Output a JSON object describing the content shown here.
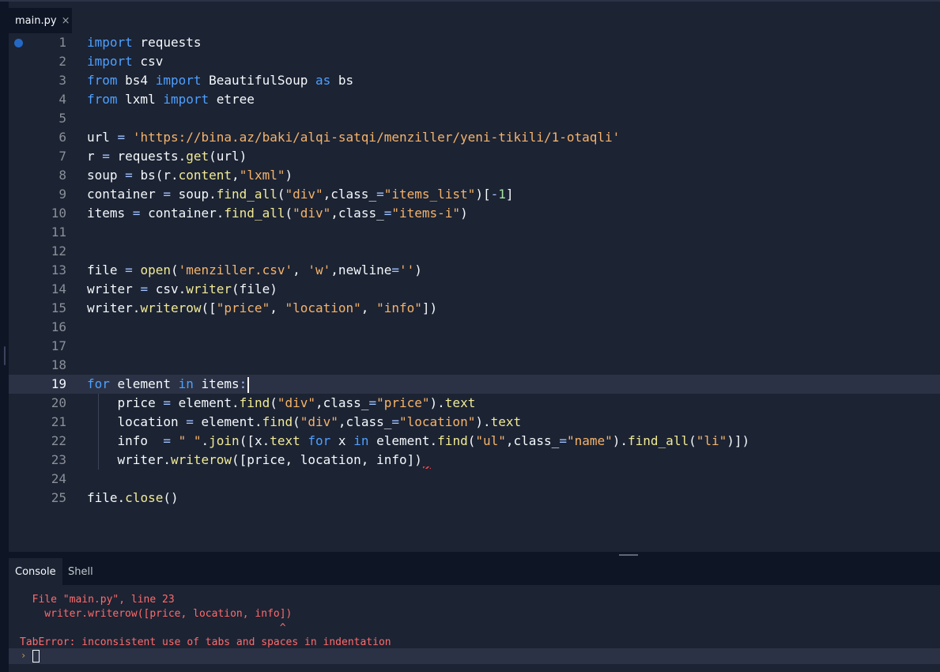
{
  "editor_tab": {
    "filename": "main.py",
    "close_glyph": "×"
  },
  "code": {
    "active_line": 19,
    "lines": [
      {
        "n": "1"
      },
      {
        "n": "2"
      },
      {
        "n": "3"
      },
      {
        "n": "4"
      },
      {
        "n": "5"
      },
      {
        "n": "6"
      },
      {
        "n": "7"
      },
      {
        "n": "8"
      },
      {
        "n": "9"
      },
      {
        "n": "10"
      },
      {
        "n": "11"
      },
      {
        "n": "12"
      },
      {
        "n": "13"
      },
      {
        "n": "14"
      },
      {
        "n": "15"
      },
      {
        "n": "16"
      },
      {
        "n": "17"
      },
      {
        "n": "18"
      },
      {
        "n": "19"
      },
      {
        "n": "20"
      },
      {
        "n": "21"
      },
      {
        "n": "22"
      },
      {
        "n": "23"
      },
      {
        "n": "24"
      },
      {
        "n": "25"
      }
    ],
    "t": {
      "import": "import",
      "from": "from",
      "as": "as",
      "for": "for",
      "in": "in",
      "requests": " requests",
      "csv": " csv",
      "bs4": " bs4 ",
      "BeautifulSoup": " BeautifulSoup ",
      "bs": " bs",
      "lxml": " lxml ",
      "etree": " etree",
      "l6a": "url ",
      "eq": "=",
      "l6b": " ",
      "url_str": "'https://bina.az/baki/alqi-satqi/menziller/yeni-tikili/1-otaqli'",
      "l7a": "r ",
      "l7b": " requests.",
      "get": "get",
      "l7c": "(url)",
      "l8a": "soup ",
      "l8b": " bs(r.",
      "content": "content",
      "l8c": ",",
      "lxml_str": "\"lxml\"",
      "close_paren": ")",
      "l9a": "container ",
      "l9b": " soup.",
      "find_all": "find_all",
      "open_paren": "(",
      "div_str": "\"div\"",
      "class_kw": ",class_",
      "items_list_str": "\"items_list\"",
      "l9c": ")[",
      "neg": "-",
      "one": "1",
      "rb": "]",
      "l10a": "items ",
      "l10b": " container.",
      "items_i_str": "\"items-i\"",
      "l13a": "file ",
      "open_fn": "open",
      "menz_str": "'menziller.csv'",
      "comma_sp": ", ",
      "w_str": "'w'",
      "newline_kw": ",newline",
      "empty_str": "''",
      "l14a": "writer ",
      "l14b": " csv.",
      "writer_fn": "writer",
      "l14c": "(file)",
      "l15a": "writer.",
      "writerow_fn": "writerow",
      "lb": "([",
      "price_str": "\"price\"",
      "location_str": "\"location\"",
      "info_str": "\"info\"",
      "rbp": "])",
      "element": " element ",
      "items_colon": " items",
      "colon": ":",
      "l20a": "    price ",
      "l20b": " element.",
      "find_fn": "find",
      "price_cls": "\"price\"",
      "text_tail": ").",
      "text": "text",
      "l21a": "    location ",
      "location_cls": "\"location\"",
      "l22a": "    info  ",
      "space_str": "\" \"",
      "dot": ".",
      "join_fn": "join",
      "l22b": "([x.",
      "x_var": " x ",
      "element_dot": " element.",
      "ul_str": "\"ul\"",
      "name_cls": "\"name\"",
      "find_all_tail": ").",
      "li_str": "\"li\"",
      "l22c": ")])",
      "l23a": "    writer.",
      "l23b": "([price, location, info])",
      "l25a": "file.",
      "close_fn": "close",
      "l25b": "()"
    }
  },
  "console_tabs": [
    {
      "label": "Console",
      "active": true
    },
    {
      "label": "Shell",
      "active": false
    }
  ],
  "console": {
    "lines": [
      "  File \"main.py\", line 23",
      "    writer.writerow([price, location, info])",
      "                                          ^",
      "TabError: inconsistent use of tabs and spaces in indentation"
    ],
    "prompt_glyph": "›"
  },
  "colors": {
    "editor_bg": "#1c2333",
    "keyword": "#4da0ff",
    "string": "#f5b36a",
    "function": "#f0ea95",
    "error": "#ff6b6b",
    "breakpoint": "#2468c4"
  },
  "icons": {
    "breakpoint": "breakpoint-dot-icon",
    "close": "close-icon",
    "prompt": "prompt-chevron-icon"
  }
}
